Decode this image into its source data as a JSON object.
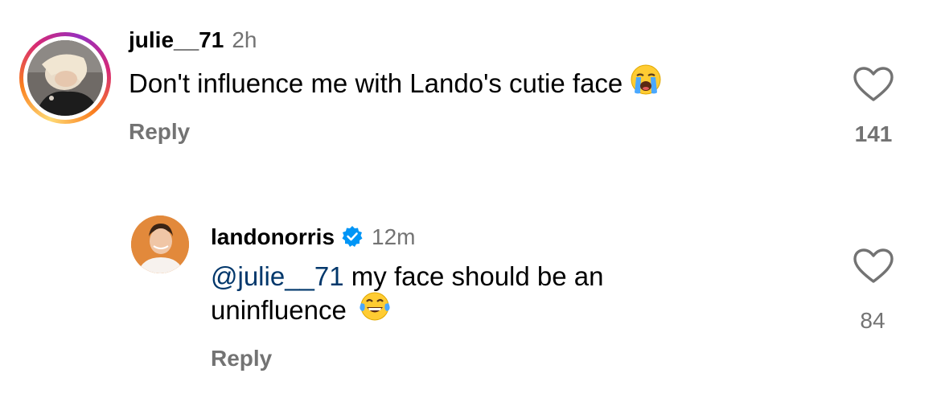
{
  "comments": [
    {
      "username": "julie__71",
      "time": "2h",
      "text": "Don't influence me with Lando's cutie face",
      "emoji": "loudly-crying-face",
      "reply_label": "Reply",
      "likes": "141",
      "avatar": "user-photo-with-story-ring"
    }
  ],
  "reply": {
    "username": "landonorris",
    "verified": true,
    "time": "12m",
    "mention": "@julie__71",
    "text_line1": " my face should be an",
    "text_line2": "uninfluence",
    "emoji": "face-with-tears-of-joy",
    "reply_label": "Reply",
    "likes": "84",
    "avatar": "user-photo-orange-background"
  },
  "colors": {
    "text": "#000000",
    "secondary": "#737373",
    "mention": "#00376b",
    "verified": "#0095f6"
  }
}
